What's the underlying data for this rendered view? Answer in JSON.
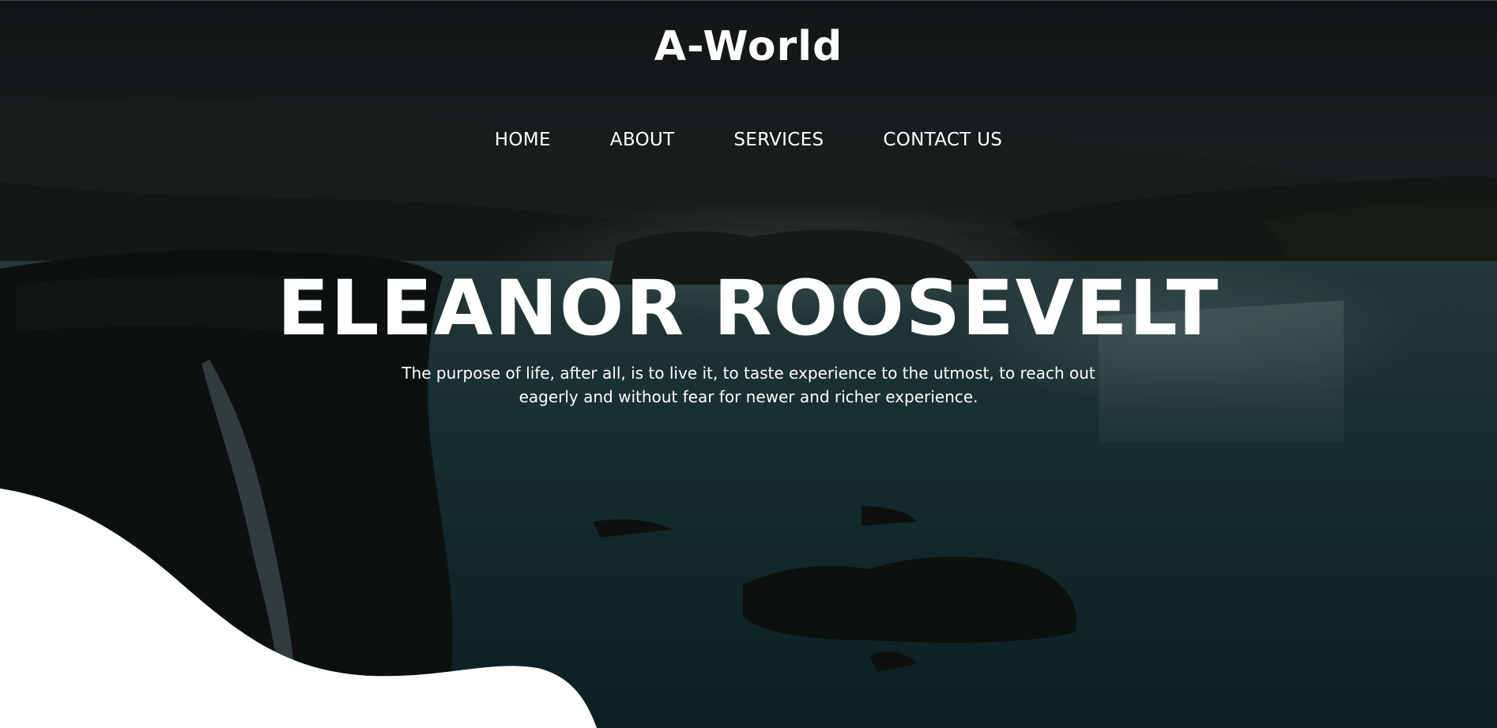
{
  "brand": {
    "logo_text": "A-World"
  },
  "nav": {
    "items": [
      {
        "label": "HOME"
      },
      {
        "label": "ABOUT"
      },
      {
        "label": "SERVICES"
      },
      {
        "label": "CONTACT US"
      }
    ]
  },
  "hero": {
    "headline": "ELEANOR ROOSEVELT",
    "quote": "The purpose of life, after all, is to live it, to taste experience to the utmost, to reach out eagerly and without fear for newer and richer experience."
  },
  "colors": {
    "text": "#ffffff",
    "wave": "#ffffff",
    "sky": "#2a3033",
    "water": "#1f4a4f"
  }
}
